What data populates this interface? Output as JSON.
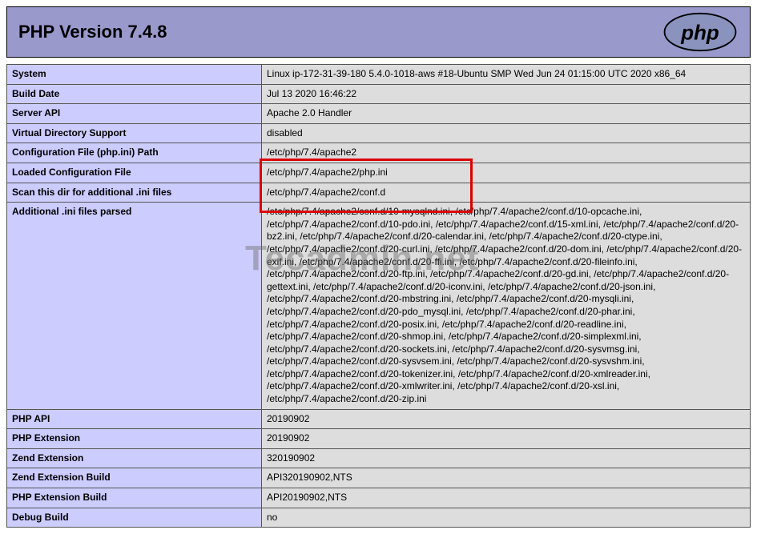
{
  "header": {
    "title": "PHP Version 7.4.8",
    "logo_alt": "php"
  },
  "rows": [
    {
      "label": "System",
      "value": "Linux ip-172-31-39-180 5.4.0-1018-aws #18-Ubuntu SMP Wed Jun 24 01:15:00 UTC 2020 x86_64"
    },
    {
      "label": "Build Date",
      "value": "Jul 13 2020 16:46:22"
    },
    {
      "label": "Server API",
      "value": "Apache 2.0 Handler"
    },
    {
      "label": "Virtual Directory Support",
      "value": "disabled"
    },
    {
      "label": "Configuration File (php.ini) Path",
      "value": "/etc/php/7.4/apache2"
    },
    {
      "label": "Loaded Configuration File",
      "value": "/etc/php/7.4/apache2/php.ini"
    },
    {
      "label": "Scan this dir for additional .ini files",
      "value": "/etc/php/7.4/apache2/conf.d"
    },
    {
      "label": "Additional .ini files parsed",
      "value": "/etc/php/7.4/apache2/conf.d/10-mysqlnd.ini, /etc/php/7.4/apache2/conf.d/10-opcache.ini, /etc/php/7.4/apache2/conf.d/10-pdo.ini, /etc/php/7.4/apache2/conf.d/15-xml.ini, /etc/php/7.4/apache2/conf.d/20-bz2.ini, /etc/php/7.4/apache2/conf.d/20-calendar.ini, /etc/php/7.4/apache2/conf.d/20-ctype.ini, /etc/php/7.4/apache2/conf.d/20-curl.ini, /etc/php/7.4/apache2/conf.d/20-dom.ini, /etc/php/7.4/apache2/conf.d/20-exif.ini, /etc/php/7.4/apache2/conf.d/20-ffi.ini, /etc/php/7.4/apache2/conf.d/20-fileinfo.ini, /etc/php/7.4/apache2/conf.d/20-ftp.ini, /etc/php/7.4/apache2/conf.d/20-gd.ini, /etc/php/7.4/apache2/conf.d/20-gettext.ini, /etc/php/7.4/apache2/conf.d/20-iconv.ini, /etc/php/7.4/apache2/conf.d/20-json.ini, /etc/php/7.4/apache2/conf.d/20-mbstring.ini, /etc/php/7.4/apache2/conf.d/20-mysqli.ini, /etc/php/7.4/apache2/conf.d/20-pdo_mysql.ini, /etc/php/7.4/apache2/conf.d/20-phar.ini, /etc/php/7.4/apache2/conf.d/20-posix.ini, /etc/php/7.4/apache2/conf.d/20-readline.ini, /etc/php/7.4/apache2/conf.d/20-shmop.ini, /etc/php/7.4/apache2/conf.d/20-simplexml.ini, /etc/php/7.4/apache2/conf.d/20-sockets.ini, /etc/php/7.4/apache2/conf.d/20-sysvmsg.ini, /etc/php/7.4/apache2/conf.d/20-sysvsem.ini, /etc/php/7.4/apache2/conf.d/20-sysvshm.ini, /etc/php/7.4/apache2/conf.d/20-tokenizer.ini, /etc/php/7.4/apache2/conf.d/20-xmlreader.ini, /etc/php/7.4/apache2/conf.d/20-xmlwriter.ini, /etc/php/7.4/apache2/conf.d/20-xsl.ini, /etc/php/7.4/apache2/conf.d/20-zip.ini"
    },
    {
      "label": "PHP API",
      "value": "20190902"
    },
    {
      "label": "PHP Extension",
      "value": "20190902"
    },
    {
      "label": "Zend Extension",
      "value": "320190902"
    },
    {
      "label": "Zend Extension Build",
      "value": "API320190902,NTS"
    },
    {
      "label": "PHP Extension Build",
      "value": "API20190902,NTS"
    },
    {
      "label": "Debug Build",
      "value": "no"
    }
  ],
  "watermark": "Tecadmin.net"
}
